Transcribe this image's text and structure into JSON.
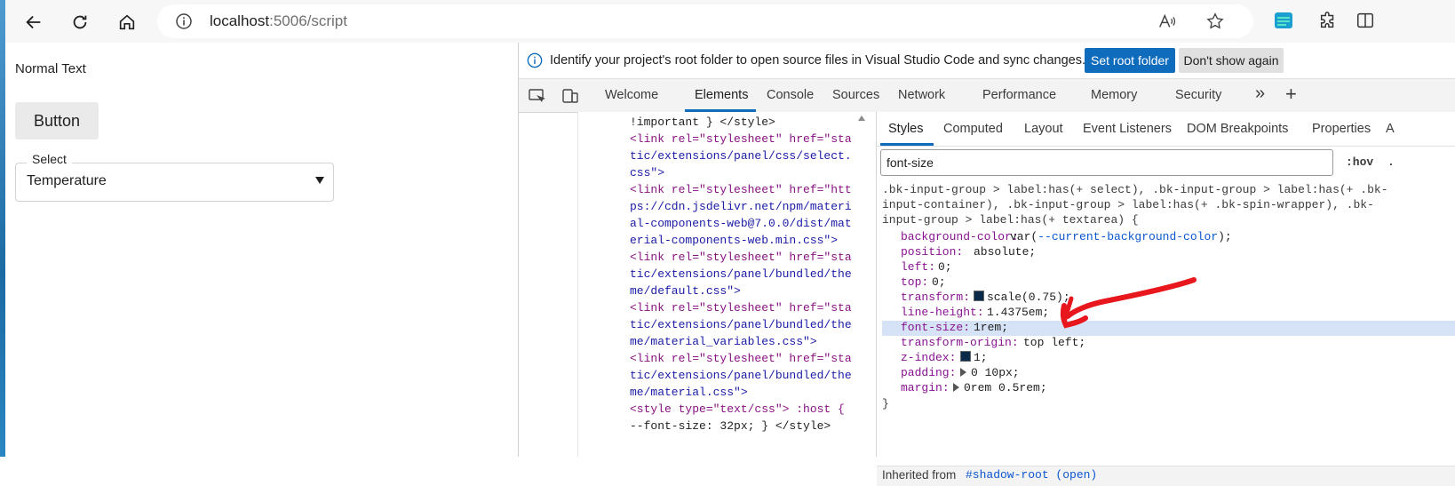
{
  "browser": {
    "url_host": "localhost",
    "url_rest": ":5006/script"
  },
  "page": {
    "normal_text": "Normal Text",
    "button_label": "Button",
    "select_label": "Select",
    "select_value": "Temperature"
  },
  "devtools": {
    "infobar": {
      "message": "Identify your project's root folder to open source files in Visual Studio Code and sync changes.",
      "set_root_label": "Set root folder",
      "dont_show_label": "Don't show again"
    },
    "tabs": [
      "Welcome",
      "Elements",
      "Console",
      "Sources",
      "Network",
      "Performance",
      "Memory",
      "Security"
    ],
    "active_tab": "Elements",
    "more_tabs": "»",
    "add_tab": "+",
    "code_lines": [
      "!important } </style>",
      "<link rel=\"stylesheet\" href=\"sta",
      "tic/extensions/panel/css/select.",
      "css\">",
      "<link rel=\"stylesheet\" href=\"htt",
      "ps://cdn.jsdelivr.net/npm/materi",
      "al-components-web@7.0.0/dist/mat",
      "erial-components-web.min.css\">",
      "<link rel=\"stylesheet\" href=\"sta",
      "tic/extensions/panel/bundled/the",
      "me/default.css\">",
      "<link rel=\"stylesheet\" href=\"sta",
      "tic/extensions/panel/bundled/the",
      "me/material_variables.css\">",
      "<link rel=\"stylesheet\" href=\"sta",
      "tic/extensions/panel/bundled/the",
      "me/material.css\">",
      "<style type=\"text/css\"> :host {",
      "--font-size: 32px; } </style>"
    ],
    "styles": {
      "tabs": [
        "Styles",
        "Computed",
        "Layout",
        "Event Listeners",
        "DOM Breakpoints",
        "Properties",
        "A"
      ],
      "filter_value": "font-size",
      "hov": ":hov",
      "cls": ".",
      "selector_lines": [
        ".bk-input-group > label:has(+ select), .bk-input-group > label:has(+ .bk-",
        "input-container), .bk-input-group > label:has(+ .bk-spin-wrapper), .bk-",
        "input-group > label:has(+ textarea) {"
      ],
      "properties": [
        {
          "name": "background-color",
          "value_pre": "var(",
          "value_var": "--current-background-color",
          "value_post": ");"
        },
        {
          "name": "position",
          "value": "absolute;"
        },
        {
          "name": "left",
          "value": "0;"
        },
        {
          "name": "top",
          "value": "0;"
        },
        {
          "name": "transform",
          "value": "scale(0.75);"
        },
        {
          "name": "line-height",
          "value": "1.4375em;"
        },
        {
          "name": "font-size",
          "value": "1rem;"
        },
        {
          "name": "transform-origin",
          "value": "top left;"
        },
        {
          "name": "z-index",
          "value": "1;"
        },
        {
          "name": "padding",
          "value": "0 10px;"
        },
        {
          "name": "margin",
          "value": "0rem 0.5rem;"
        }
      ],
      "close_brace": "}",
      "inherited_label": "Inherited from",
      "inherited_link": "#shadow-root (open)"
    }
  },
  "colors": {
    "accent": "#0f6cbd",
    "annotation": "#e8161d",
    "highlight": "#d6e3f7"
  },
  "icons": [
    "back-icon",
    "refresh-icon",
    "home-icon",
    "info-icon",
    "read-aloud-icon",
    "favorite-icon",
    "extension-icon",
    "puzzle-icon",
    "split-screen-icon",
    "inspect-icon",
    "device-icon"
  ]
}
